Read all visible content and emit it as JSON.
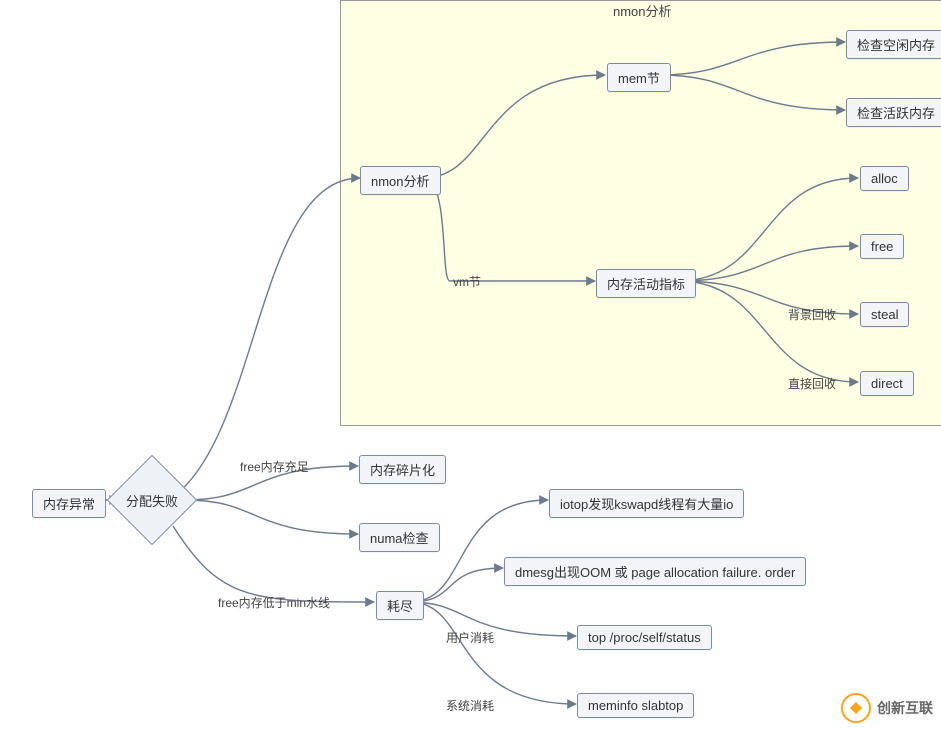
{
  "group": {
    "title": "nmon分析"
  },
  "nodes": {
    "mem_anomaly": "内存异常",
    "alloc_fail": "分配失败",
    "nmon_analysis": "nmon分析",
    "mem_section": "mem节",
    "check_free_mem": "检查空闲内存",
    "check_active_mem": "检查活跃内存",
    "vm_section": "vm节",
    "mem_activity_index": "内存活动指标",
    "alloc": "alloc",
    "free": "free",
    "steal": "steal",
    "direct": "direct",
    "fragmentation": "内存碎片化",
    "numa_check": "numa检查",
    "exhaust": "耗尽",
    "iotop": "iotop发现kswapd线程有大量io",
    "dmesg": "dmesg出现OOM 或 page allocation failure. order",
    "topproc": "top /proc/self/status",
    "meminfo": "meminfo slabtop"
  },
  "edge_labels": {
    "free_enough": "free内存充足",
    "free_low": "free内存低于min水线",
    "bg_reclaim": "背景回收",
    "direct_reclaim": "直接回收",
    "user_consume": "用户消耗",
    "sys_consume": "系统消耗"
  },
  "watermark": {
    "text": "创新互联"
  },
  "chart_data": {
    "type": "diagram",
    "title": "nmon分析",
    "nodes": [
      {
        "id": "mem_anomaly",
        "label": "内存异常",
        "shape": "rect"
      },
      {
        "id": "alloc_fail",
        "label": "分配失败",
        "shape": "diamond"
      },
      {
        "id": "nmon_analysis",
        "label": "nmon分析",
        "shape": "rect",
        "group": "nmon分析"
      },
      {
        "id": "mem_section",
        "label": "mem节",
        "shape": "rect",
        "group": "nmon分析"
      },
      {
        "id": "check_free_mem",
        "label": "检查空闲内存",
        "shape": "rect",
        "group": "nmon分析"
      },
      {
        "id": "check_active_mem",
        "label": "检查活跃内存",
        "shape": "rect",
        "group": "nmon分析"
      },
      {
        "id": "vm_section",
        "label": "vm节",
        "shape": "text",
        "group": "nmon分析"
      },
      {
        "id": "mem_activity_index",
        "label": "内存活动指标",
        "shape": "rect",
        "group": "nmon分析"
      },
      {
        "id": "alloc",
        "label": "alloc",
        "shape": "rect",
        "group": "nmon分析"
      },
      {
        "id": "free",
        "label": "free",
        "shape": "rect",
        "group": "nmon分析"
      },
      {
        "id": "steal",
        "label": "steal",
        "shape": "rect",
        "group": "nmon分析"
      },
      {
        "id": "direct",
        "label": "direct",
        "shape": "rect",
        "group": "nmon分析"
      },
      {
        "id": "fragmentation",
        "label": "内存碎片化",
        "shape": "rect"
      },
      {
        "id": "numa_check",
        "label": "numa检查",
        "shape": "rect"
      },
      {
        "id": "exhaust",
        "label": "耗尽",
        "shape": "rect"
      },
      {
        "id": "iotop",
        "label": "iotop发现kswapd线程有大量io",
        "shape": "rect"
      },
      {
        "id": "dmesg",
        "label": "dmesg出现OOM 或 page allocation failure. order",
        "shape": "rect"
      },
      {
        "id": "topproc",
        "label": "top /proc/self/status",
        "shape": "rect"
      },
      {
        "id": "meminfo",
        "label": "meminfo slabtop",
        "shape": "rect"
      }
    ],
    "edges": [
      {
        "from": "mem_anomaly",
        "to": "alloc_fail"
      },
      {
        "from": "alloc_fail",
        "to": "nmon_analysis"
      },
      {
        "from": "nmon_analysis",
        "to": "mem_section"
      },
      {
        "from": "mem_section",
        "to": "check_free_mem"
      },
      {
        "from": "mem_section",
        "to": "check_active_mem"
      },
      {
        "from": "nmon_analysis",
        "to": "vm_section"
      },
      {
        "from": "vm_section",
        "to": "mem_activity_index"
      },
      {
        "from": "mem_activity_index",
        "to": "alloc"
      },
      {
        "from": "mem_activity_index",
        "to": "free"
      },
      {
        "from": "mem_activity_index",
        "to": "steal",
        "label": "背景回收"
      },
      {
        "from": "mem_activity_index",
        "to": "direct",
        "label": "直接回收"
      },
      {
        "from": "alloc_fail",
        "to": "fragmentation",
        "label": "free内存充足"
      },
      {
        "from": "alloc_fail",
        "to": "numa_check"
      },
      {
        "from": "alloc_fail",
        "to": "exhaust",
        "label": "free内存低于min水线"
      },
      {
        "from": "exhaust",
        "to": "iotop"
      },
      {
        "from": "exhaust",
        "to": "dmesg"
      },
      {
        "from": "exhaust",
        "to": "topproc",
        "label": "用户消耗"
      },
      {
        "from": "exhaust",
        "to": "meminfo",
        "label": "系统消耗"
      }
    ],
    "groups": [
      {
        "id": "nmon_group",
        "label": "nmon分析",
        "members": [
          "nmon_analysis",
          "mem_section",
          "check_free_mem",
          "check_active_mem",
          "vm_section",
          "mem_activity_index",
          "alloc",
          "free",
          "steal",
          "direct"
        ]
      }
    ]
  }
}
